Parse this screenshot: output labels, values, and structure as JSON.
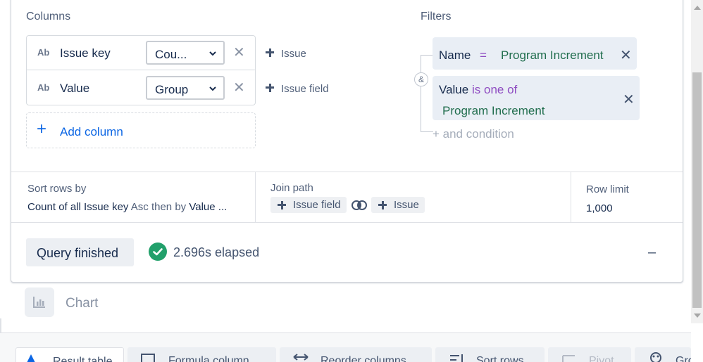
{
  "columns": {
    "heading": "Columns",
    "rows": [
      {
        "icon": "Ab",
        "name": "Issue key",
        "aggregation": "Cou...",
        "source": "Issue"
      },
      {
        "icon": "Ab",
        "name": "Value",
        "aggregation": "Group",
        "source": "Issue field"
      }
    ],
    "add_label": "Add column"
  },
  "filters": {
    "heading": "Filters",
    "combinator": "&",
    "items": [
      {
        "field": "Name",
        "operator": "=",
        "value": "Program Increment"
      },
      {
        "field": "Value",
        "operator": "is one of",
        "value": "Program Increment"
      }
    ],
    "add_condition": "+ and condition"
  },
  "sort": {
    "label": "Sort rows by",
    "field1": "Count of all Issue key",
    "dir1": "Asc",
    "then": "then by",
    "field2": "Value",
    "ellipsis": "..."
  },
  "join": {
    "label": "Join path",
    "from": "Issue field",
    "to": "Issue"
  },
  "row_limit": {
    "label": "Row limit",
    "value": "1,000"
  },
  "status": {
    "button": "Query finished",
    "elapsed": "2.696s elapsed",
    "collapse": "–"
  },
  "chart_step": {
    "label": "Chart"
  },
  "toolbar": {
    "items": [
      "Result table",
      "Formula column",
      "Reorder columns",
      "Sort rows",
      "Pivot",
      "Gro"
    ]
  },
  "colors": {
    "accent_blue": "#0c66e4",
    "success_green": "#22a06b",
    "filter_value_green": "#216e4e",
    "operator_purple": "#8f4dc2"
  }
}
